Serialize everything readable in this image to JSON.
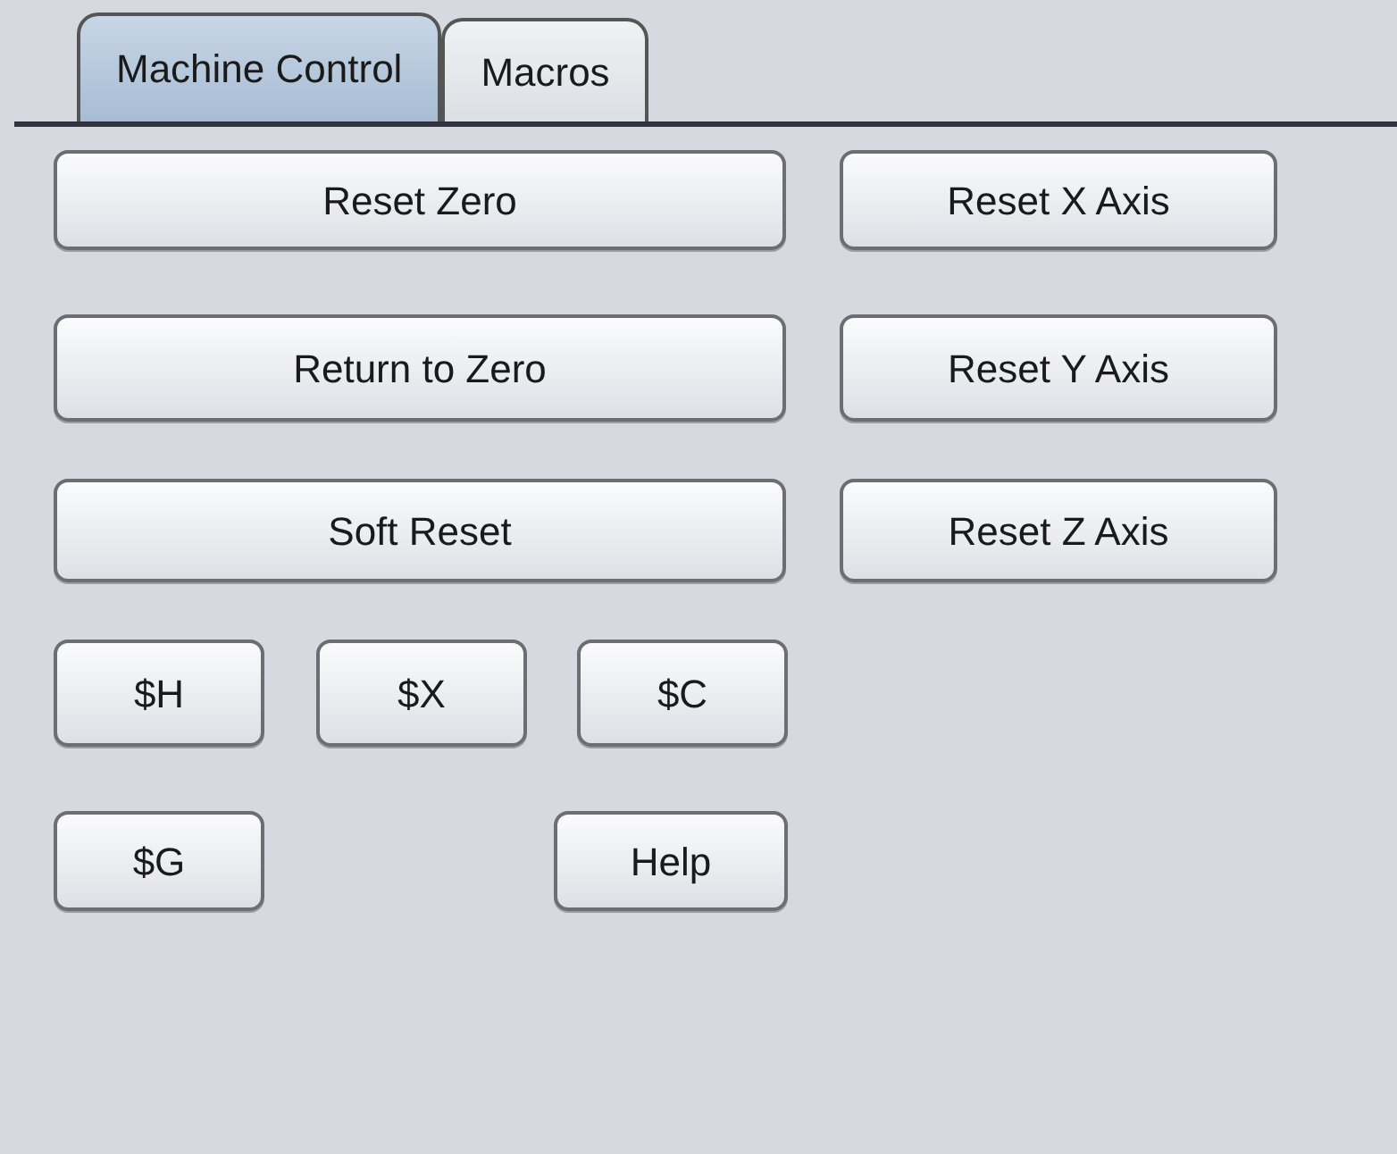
{
  "tabs": [
    {
      "label": "Machine Control",
      "selected": true
    },
    {
      "label": "Macros",
      "selected": false
    }
  ],
  "button_rows": [
    [
      "Reset Zero",
      "Reset X Axis"
    ],
    [
      "Return to Zero",
      "Reset Y Axis"
    ],
    [
      "Soft Reset",
      "Reset Z Axis"
    ],
    [
      "$H",
      "$X",
      "$C"
    ],
    [
      "$G",
      "Help"
    ]
  ]
}
